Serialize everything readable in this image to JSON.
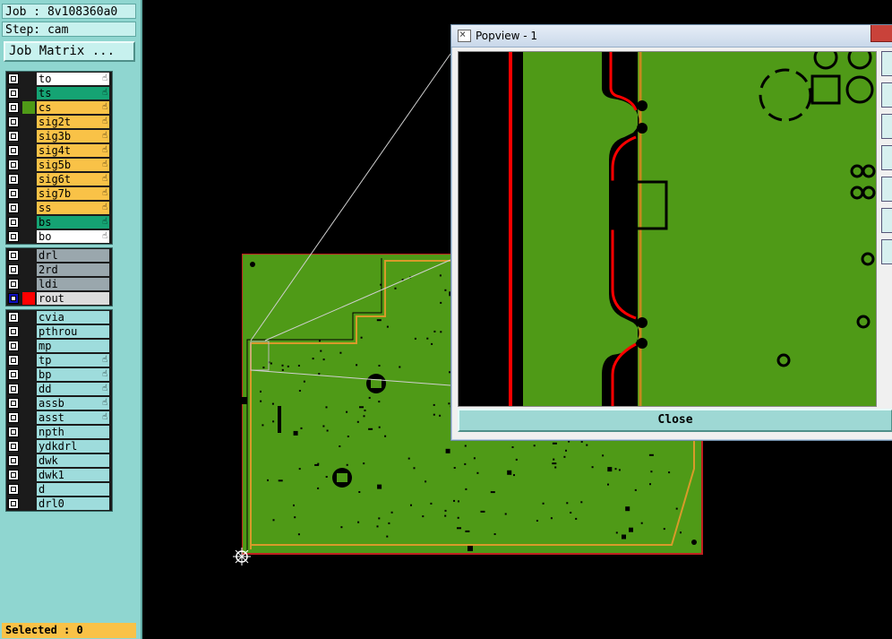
{
  "job": {
    "job_text": "Job : 8v108360a0",
    "step_text": "Step: cam",
    "matrix_button": "Job Matrix ..."
  },
  "layers_signal": [
    {
      "name": "to",
      "color": "#ffffff",
      "hand": true
    },
    {
      "name": "ts",
      "color": "#15a373",
      "hand": true
    },
    {
      "name": "cs",
      "color": "#f9c247",
      "hand": true,
      "swatch": "#4f9a17"
    },
    {
      "name": "sig2t",
      "color": "#f9c247",
      "hand": true
    },
    {
      "name": "sig3b",
      "color": "#f9c247",
      "hand": true
    },
    {
      "name": "sig4t",
      "color": "#f9c247",
      "hand": true
    },
    {
      "name": "sig5b",
      "color": "#f9c247",
      "hand": true
    },
    {
      "name": "sig6t",
      "color": "#f9c247",
      "hand": true
    },
    {
      "name": "sig7b",
      "color": "#f9c247",
      "hand": true
    },
    {
      "name": "ss",
      "color": "#f9c247",
      "hand": true
    },
    {
      "name": "bs",
      "color": "#15a373",
      "hand": true
    },
    {
      "name": "bo",
      "color": "#ffffff",
      "hand": true
    }
  ],
  "layers_drill": [
    {
      "name": "drl",
      "color": "#9aa7ad",
      "hand": false
    },
    {
      "name": "2rd",
      "color": "#9aa7ad",
      "hand": false
    },
    {
      "name": "ldi",
      "color": "#9aa7ad",
      "hand": false
    },
    {
      "name": "rout",
      "color": "#dcdcdc",
      "hand": false,
      "swatch": "#ff0000",
      "active": true
    }
  ],
  "layers_misc": [
    {
      "name": "cvia",
      "color": "#9edcdc",
      "hand": false
    },
    {
      "name": "pthrou",
      "color": "#9edcdc",
      "hand": false
    },
    {
      "name": "mp",
      "color": "#9edcdc",
      "hand": false
    },
    {
      "name": "tp",
      "color": "#9edcdc",
      "hand": true
    },
    {
      "name": "bp",
      "color": "#9edcdc",
      "hand": true
    },
    {
      "name": "dd",
      "color": "#9edcdc",
      "hand": true
    },
    {
      "name": "assb",
      "color": "#9edcdc",
      "hand": true
    },
    {
      "name": "asst",
      "color": "#9edcdc",
      "hand": true
    },
    {
      "name": "npth",
      "color": "#9edcdc",
      "hand": false
    },
    {
      "name": "ydkdrl",
      "color": "#9edcdc",
      "hand": false
    },
    {
      "name": "dwk",
      "color": "#9edcdc",
      "hand": false
    },
    {
      "name": "dwk1",
      "color": "#9edcdc",
      "hand": false
    },
    {
      "name": "d",
      "color": "#9edcdc",
      "hand": false
    },
    {
      "name": "drl0",
      "color": "#9edcdc",
      "hand": false
    }
  ],
  "status": {
    "selected_text": "Selected : 0"
  },
  "popview": {
    "title": "Popview - 1",
    "close_label": "Close"
  },
  "colors": {
    "board_green": "#4f9a17",
    "rout_red": "#ff0000",
    "copper_orange": "#d89a2a"
  }
}
